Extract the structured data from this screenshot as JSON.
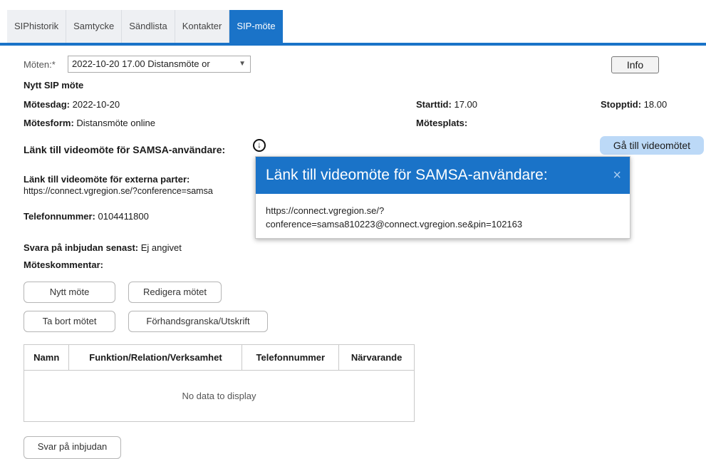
{
  "tabs": [
    {
      "label": "SIPhistorik",
      "active": false
    },
    {
      "label": "Samtycke",
      "active": false
    },
    {
      "label": "Sändlista",
      "active": false
    },
    {
      "label": "Kontakter",
      "active": false
    },
    {
      "label": "SIP-möte",
      "active": true
    }
  ],
  "meeting": {
    "select_label": "Möten:*",
    "select_value": "2022-10-20 17.00 Distansmöte or",
    "heading": "Nytt SIP möte",
    "date_label": "Mötesdag:",
    "date_value": "2022-10-20",
    "start_label": "Starttid:",
    "start_value": "17.00",
    "stop_label": "Stopptid:",
    "stop_value": "18.00",
    "form_label": "Mötesform:",
    "form_value": "Distansmöte online",
    "place_label": "Mötesplats:",
    "samsa_link_label": "Länk till videomöte för SAMSA-användare:",
    "external_link_label": "Länk till videomöte för externa parter:",
    "external_link_value": "https://connect.vgregion.se/?conference=samsa",
    "phone_label": "Telefonnummer:",
    "phone_value": "0104411800",
    "reply_label": "Svara på inbjudan senast:",
    "reply_value": "Ej angivet",
    "comment_label": "Möteskommentar:"
  },
  "buttons": {
    "info": "Info",
    "video": "Gå till videomötet",
    "new_meeting": "Nytt möte",
    "edit_meeting": "Redigera mötet",
    "delete_meeting": "Ta bort mötet",
    "preview": "Förhandsgranska/Utskrift",
    "reply": "Svar på inbjudan"
  },
  "popup": {
    "title": "Länk till videomöte för SAMSA-användare:",
    "close": "×",
    "body_line1": "https://connect.vgregion.se/?",
    "body_line2": "conference=samsa810223@connect.vgregion.se&pin=102163"
  },
  "table": {
    "columns": [
      "Namn",
      "Funktion/Relation/Verksamhet",
      "Telefonnummer",
      "Närvarande"
    ],
    "empty_text": "No data to display"
  },
  "colors": {
    "accent": "#1a73c8",
    "video_button": "#bcd9f7"
  }
}
